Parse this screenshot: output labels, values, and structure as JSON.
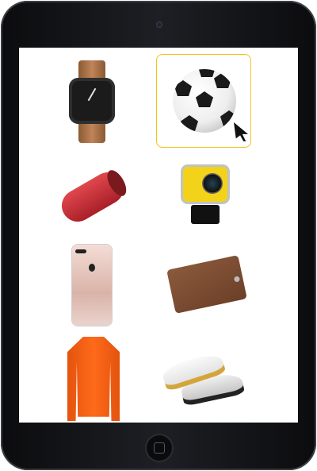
{
  "device": "tablet",
  "accent_color": "#f2c21b",
  "products": [
    {
      "icon": "wristwatch-icon",
      "selected": false
    },
    {
      "icon": "soccer-ball-icon",
      "selected": true
    },
    {
      "icon": "bluetooth-speaker-icon",
      "selected": false
    },
    {
      "icon": "action-camera-icon",
      "selected": false
    },
    {
      "icon": "smartphone-icon",
      "selected": false
    },
    {
      "icon": "leather-wallet-icon",
      "selected": false
    },
    {
      "icon": "sports-jacket-icon",
      "selected": false
    },
    {
      "icon": "soccer-shoes-icon",
      "selected": false
    }
  ],
  "cursor": "mouse-pointer-icon"
}
